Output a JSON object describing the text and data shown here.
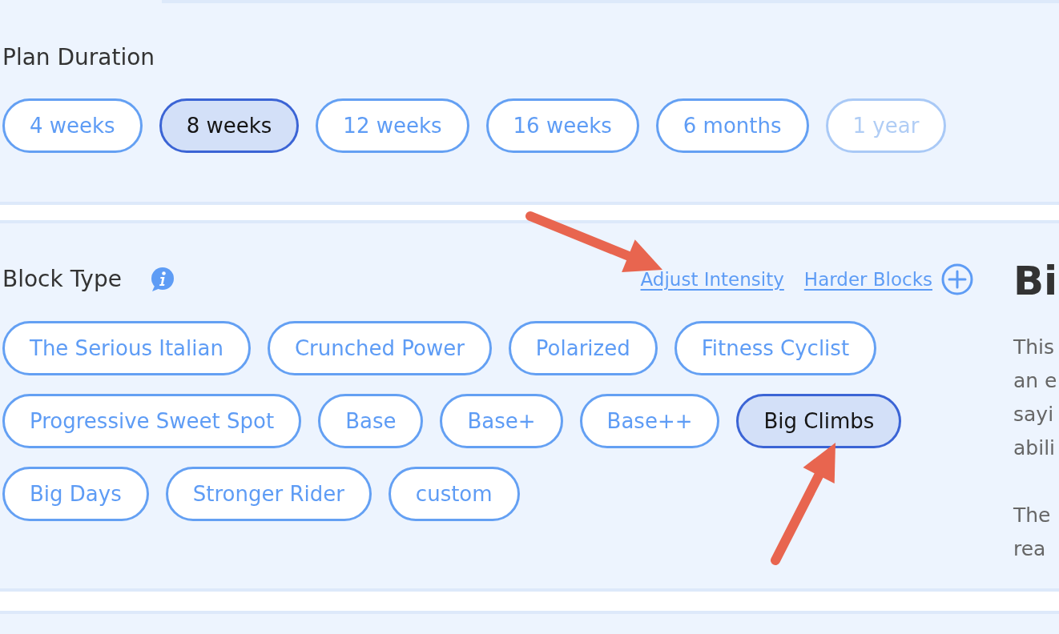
{
  "plan_duration": {
    "title": "Plan Duration",
    "options": [
      {
        "label": "4 weeks",
        "selected": false,
        "disabled": false
      },
      {
        "label": "8 weeks",
        "selected": true,
        "disabled": false
      },
      {
        "label": "12 weeks",
        "selected": false,
        "disabled": false
      },
      {
        "label": "16 weeks",
        "selected": false,
        "disabled": false
      },
      {
        "label": "6 months",
        "selected": false,
        "disabled": false
      },
      {
        "label": "1 year",
        "selected": false,
        "disabled": true
      }
    ]
  },
  "block_type": {
    "title": "Block Type",
    "links": [
      "Adjust Intensity",
      "Harder Blocks"
    ],
    "options": [
      {
        "label": "The Serious Italian",
        "selected": false
      },
      {
        "label": "Crunched Power",
        "selected": false
      },
      {
        "label": "Polarized",
        "selected": false
      },
      {
        "label": "Fitness Cyclist",
        "selected": false
      },
      {
        "label": "Progressive Sweet Spot",
        "selected": false
      },
      {
        "label": "Base",
        "selected": false
      },
      {
        "label": "Base+",
        "selected": false
      },
      {
        "label": "Base++",
        "selected": false
      },
      {
        "label": "Big Climbs",
        "selected": true
      },
      {
        "label": "Big Days",
        "selected": false
      },
      {
        "label": "Stronger Rider",
        "selected": false
      },
      {
        "label": "custom",
        "selected": false
      }
    ]
  },
  "detail": {
    "heading": "Bi",
    "paragraphs": [
      [
        "This",
        "an e",
        "sayi",
        "abili"
      ],
      [
        "The",
        "rea"
      ]
    ]
  }
}
